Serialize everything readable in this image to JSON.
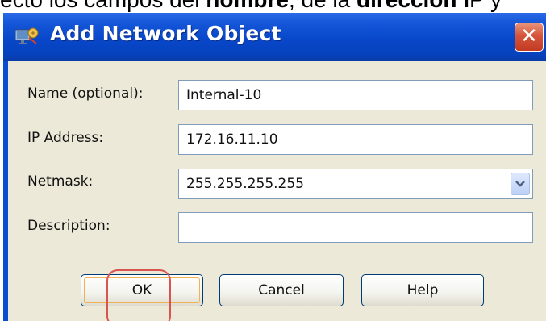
{
  "caption": {
    "before": "ecto los campos del ",
    "bold1": "nombre",
    "middle": ", de la ",
    "bold2": "dirección I",
    "after": "P y"
  },
  "window": {
    "title": "Add Network Object",
    "icon": "network-object-icon",
    "close_glyph": "✕"
  },
  "form": {
    "name": {
      "label": "Name (optional):",
      "value": "Internal-10"
    },
    "ip": {
      "label": "IP Address:",
      "value": "172.16.11.10"
    },
    "netmask": {
      "label": "Netmask:",
      "value": "255.255.255.255"
    },
    "description": {
      "label": "Description:",
      "value": ""
    }
  },
  "buttons": {
    "ok": "OK",
    "cancel": "Cancel",
    "help": "Help"
  },
  "colors": {
    "titlebar": "#0847c9",
    "dialog_bg": "#ece9d8",
    "close_button": "#d6553a",
    "highlight": "#d9534f"
  }
}
